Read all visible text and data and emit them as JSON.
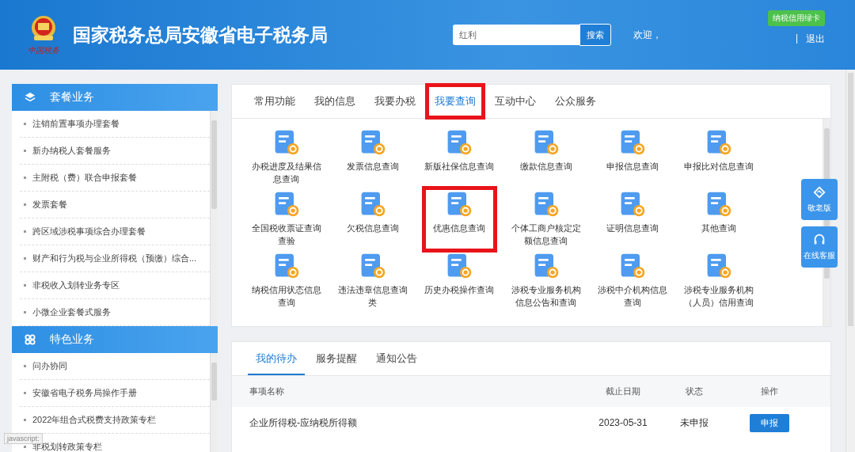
{
  "header": {
    "logo_caption": "中国税务",
    "title": "国家税务总局安徽省电子税务局",
    "search": {
      "value": "红利",
      "button": "搜索"
    },
    "welcome": "欢迎，",
    "badge": "纳税信用绿卡",
    "separator": "|",
    "logout": "退出"
  },
  "sidebar": {
    "sections": [
      {
        "title": "套餐业务",
        "kind": "layers",
        "items": [
          "注销前置事项办理套餐",
          "新办纳税人套餐服务",
          "主附税（费）联合申报套餐",
          "发票套餐",
          "跨区域涉税事项综合办理套餐",
          "财产和行为税与企业所得税（预缴）综合...",
          "非税收入划转业务专区",
          "小微企业套餐式服务"
        ]
      },
      {
        "title": "特色业务",
        "kind": "clover",
        "items": [
          "问办协同",
          "安徽省电子税务局操作手册",
          "2022年组合式税费支持政策专栏",
          "非税划转政策专栏"
        ]
      }
    ]
  },
  "main_tabs": [
    {
      "label": "常用功能",
      "selected": false,
      "highlighted": false
    },
    {
      "label": "我的信息",
      "selected": false,
      "highlighted": false
    },
    {
      "label": "我要办税",
      "selected": false,
      "highlighted": false
    },
    {
      "label": "我要查询",
      "selected": true,
      "highlighted": true
    },
    {
      "label": "互动中心",
      "selected": false,
      "highlighted": false
    },
    {
      "label": "公众服务",
      "selected": false,
      "highlighted": false
    }
  ],
  "services": [
    {
      "label": "办税进度及结果信息查询",
      "highlighted": false
    },
    {
      "label": "发票信息查询",
      "highlighted": false
    },
    {
      "label": "新版社保信息查询",
      "highlighted": false
    },
    {
      "label": "缴款信息查询",
      "highlighted": false
    },
    {
      "label": "申报信息查询",
      "highlighted": false
    },
    {
      "label": "申报比对信息查询",
      "highlighted": false
    },
    {
      "label": "全国税收票证查询查验",
      "highlighted": false
    },
    {
      "label": "欠税信息查询",
      "highlighted": false
    },
    {
      "label": "优惠信息查询",
      "highlighted": true
    },
    {
      "label": "个体工商户核定定额信息查询",
      "highlighted": false
    },
    {
      "label": "证明信息查询",
      "highlighted": false
    },
    {
      "label": "其他查询",
      "highlighted": false
    },
    {
      "label": "纳税信用状态信息查询",
      "highlighted": false
    },
    {
      "label": "违法违章信息查询类",
      "highlighted": false
    },
    {
      "label": "历史办税操作查询",
      "highlighted": false
    },
    {
      "label": "涉税专业服务机构信息公告和查询",
      "highlighted": false
    },
    {
      "label": "涉税中介机构信息查询",
      "highlighted": false
    },
    {
      "label": "涉税专业服务机构（人员）信用查询",
      "highlighted": false
    }
  ],
  "todo_tabs": [
    {
      "label": "我的待办",
      "selected": true
    },
    {
      "label": "服务提醒",
      "selected": false
    },
    {
      "label": "通知公告",
      "selected": false
    }
  ],
  "todo_table": {
    "columns": [
      "事项名称",
      "截止日期",
      "状态",
      "操作"
    ],
    "rows": [
      {
        "name": "企业所得税-应纳税所得额",
        "deadline": "2023-05-31",
        "status": "未申报",
        "action": "申报"
      }
    ]
  },
  "float_buttons": [
    {
      "label": "敬老版",
      "kind": "elder"
    },
    {
      "label": "在线客服",
      "kind": "service"
    }
  ],
  "status_text": "javascript:"
}
